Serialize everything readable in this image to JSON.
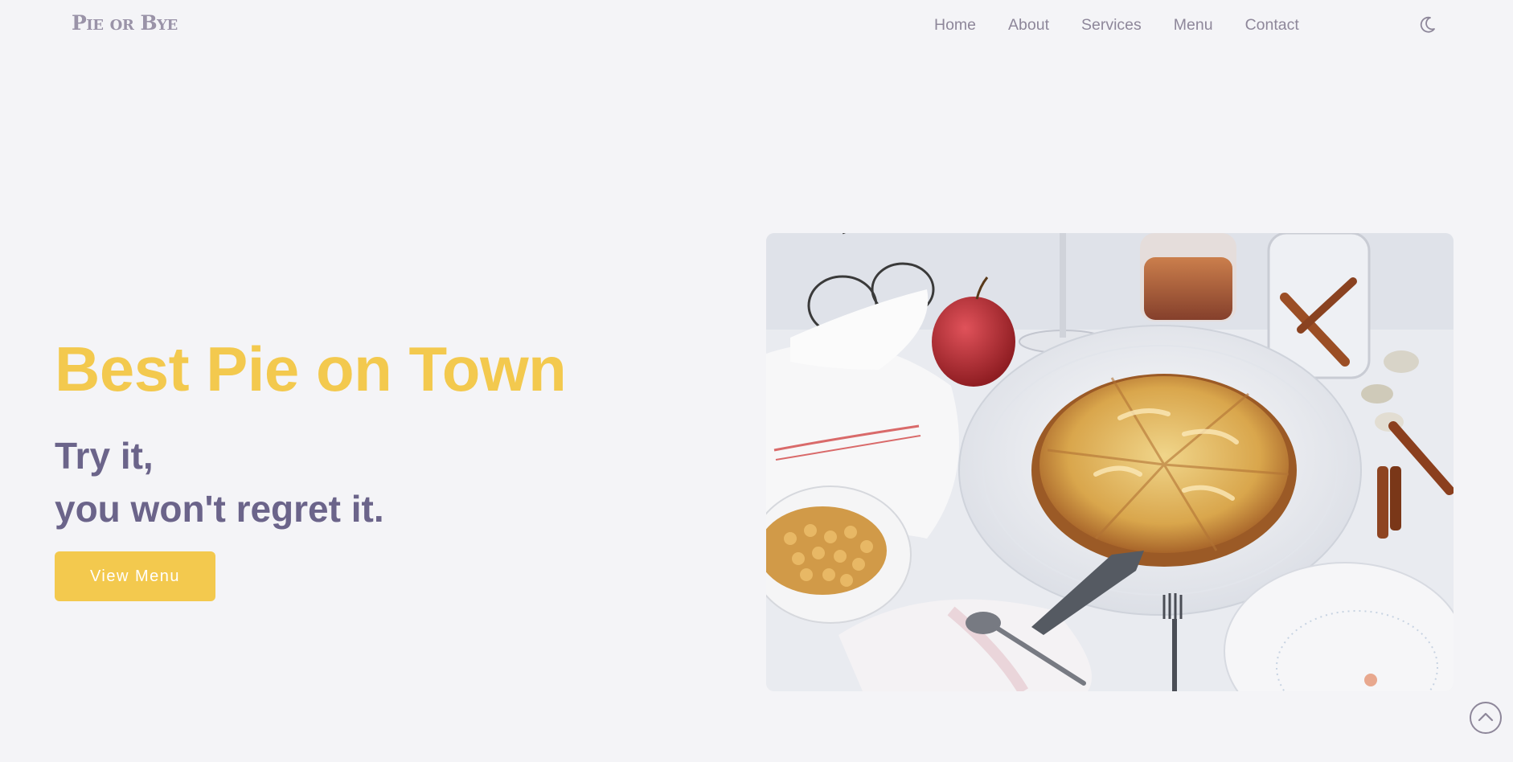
{
  "header": {
    "logo": "Pie or Bye",
    "nav": [
      "Home",
      "About",
      "Services",
      "Menu",
      "Contact"
    ],
    "theme_toggle_icon": "moon-icon"
  },
  "hero": {
    "title": "Best Pie on Town",
    "line1": "Try it,",
    "line2": "you won't regret it.",
    "cta_label": "View Menu",
    "image_subject": "apple-pie-on-table-photo"
  },
  "scroll_top_icon": "chevron-up-icon",
  "colors": {
    "background": "#f4f4f7",
    "accent": "#f3c94e",
    "heading": "#6b648a",
    "nav_text": "#8e879a",
    "logo": "#9a93a8"
  }
}
